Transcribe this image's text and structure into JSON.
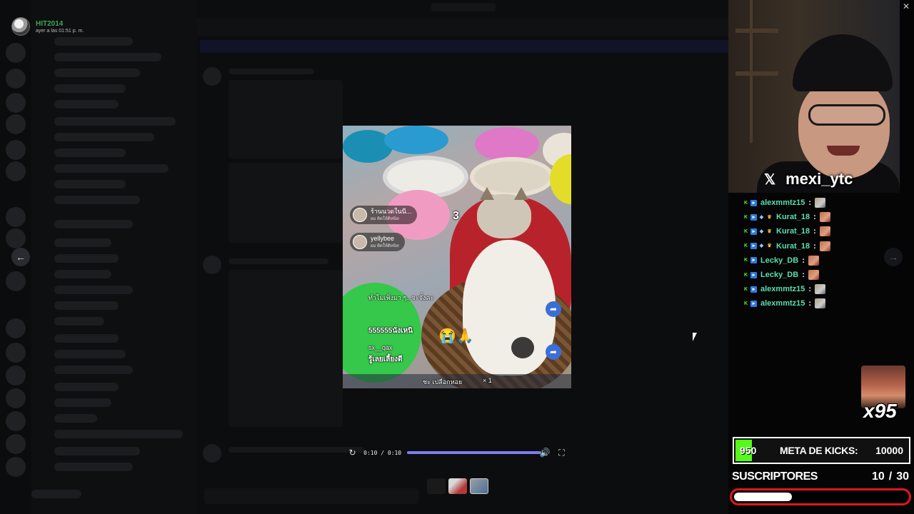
{
  "viewer": {
    "user_name": "HIT2014",
    "timestamp": "ayer a las 01:51 p. m."
  },
  "video": {
    "overlay": {
      "live_chip_1_title": "ร้านนวดในนี...",
      "live_chip_1_sub": "ผม ติดให้ดิหนิท",
      "live_chip_2_title": "yellybee",
      "live_chip_2_sub": "ผม ติดให้ดิหนิท",
      "comment_1": "ทำไมเพิ่งมา ๆ...จะจั๋งคะ",
      "comment_2": "555555นั่งเหนิ",
      "comment_3": "sx__qax",
      "comment_4": "รู้เลยเลี้ยงดี",
      "bottom_caption": "ชะ เปลือกหอย",
      "count_3": "3",
      "count_x1": "× 1"
    }
  },
  "player": {
    "time": "0:10 / 0:10",
    "progress_fraction": 1.0,
    "replay_icon": "replay-icon",
    "volume_icon": "volume-icon",
    "fullscreen_icon": "fullscreen-icon"
  },
  "stream": {
    "handle": "mexi_ytc",
    "chat": [
      {
        "user": "alexmmtz15",
        "badges": [
          "kick",
          "blue"
        ],
        "emote": "a"
      },
      {
        "user": "Kurat_18",
        "badges": [
          "kick",
          "blue",
          "gem",
          "gold"
        ],
        "emote": "b"
      },
      {
        "user": "Kurat_18",
        "badges": [
          "kick",
          "blue",
          "gem",
          "gold"
        ],
        "emote": "b"
      },
      {
        "user": "Kurat_18",
        "badges": [
          "kick",
          "blue",
          "gem",
          "gold"
        ],
        "emote": "b"
      },
      {
        "user": "Lecky_DB",
        "badges": [
          "kick",
          "blue"
        ],
        "emote": "b"
      },
      {
        "user": "Lecky_DB",
        "badges": [
          "kick",
          "blue"
        ],
        "emote": "b"
      },
      {
        "user": "alexmmtz15",
        "badges": [
          "kick",
          "blue"
        ],
        "emote": "a"
      },
      {
        "user": "alexmmtz15",
        "badges": [
          "kick",
          "blue"
        ],
        "emote": "a"
      }
    ],
    "chat_separator": ":",
    "multiplier": "x95",
    "kicks": {
      "count": "950",
      "label": "META DE KICKS:",
      "goal": "10000",
      "fill_fraction": 0.095
    },
    "subs": {
      "label": "SUSCRIPTORES",
      "count": "10",
      "separator": "/",
      "goal": "30",
      "fill_fraction": 0.333
    },
    "colors": {
      "kick_green": "#53fc18",
      "chat_name": "#57e0b0",
      "subs_border": "#e0161e",
      "seek_fill": "#7e7cf0"
    }
  }
}
